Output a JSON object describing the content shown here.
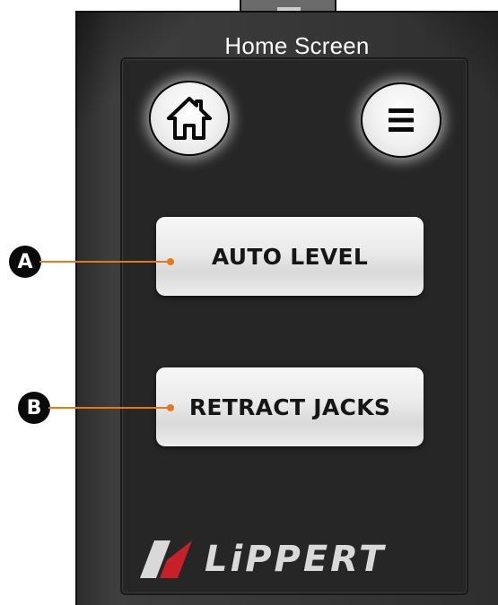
{
  "header": {
    "title": "Home Screen"
  },
  "toolbar": {
    "home_icon": "home-icon",
    "menu_icon": "hamburger-menu-icon"
  },
  "main": {
    "auto_level_label": "AUTO LEVEL",
    "retract_jacks_label": "RETRACT JACKS"
  },
  "brand": {
    "name": "LiPPERT",
    "accent_red": "#c8202a",
    "logo_gray": "#d9d9d9"
  },
  "callouts": {
    "a": "A",
    "b": "B",
    "color": "#e07a1f"
  },
  "colors": {
    "bezel": "#373737",
    "screen": "#262626",
    "button_face": "#ececec"
  }
}
